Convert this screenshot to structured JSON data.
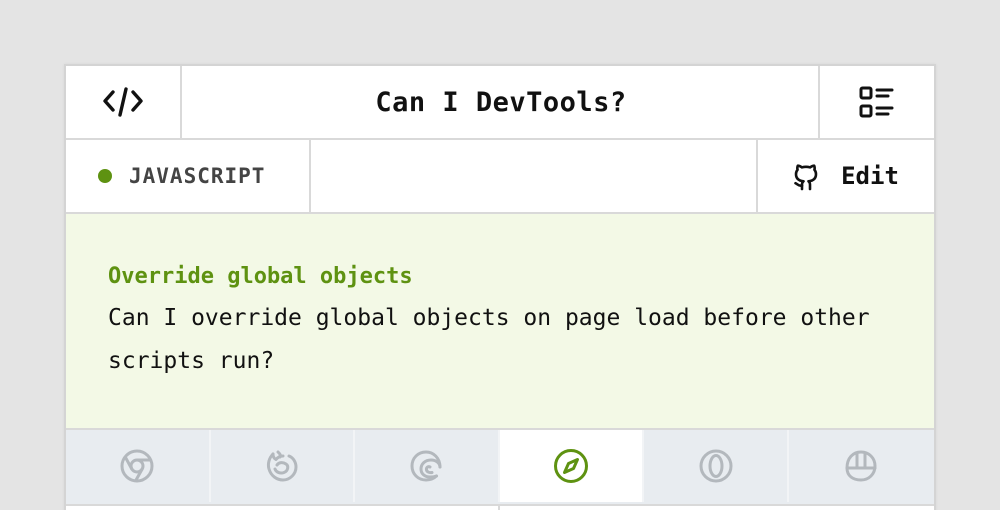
{
  "header": {
    "title": "Can I DevTools?",
    "left_icon": "code-icon",
    "right_icon": "list-view-icon"
  },
  "subbar": {
    "category_label": "JAVASCRIPT",
    "category_color": "#5e9211",
    "edit_label": "Edit",
    "edit_icon": "github-icon"
  },
  "feature": {
    "title": "Override global objects",
    "title_color": "#5e9211",
    "description": "Can I override global objects on page load before other scripts run?",
    "background": "#f3f9e6"
  },
  "browsers": [
    {
      "icon": "chrome-icon",
      "active": false
    },
    {
      "icon": "firefox-icon",
      "active": false
    },
    {
      "icon": "edge-icon",
      "active": false
    },
    {
      "icon": "safari-icon",
      "active": true
    },
    {
      "icon": "opera-icon",
      "active": false
    },
    {
      "icon": "polypane-icon",
      "active": false
    }
  ],
  "colors": {
    "accent": "#5e9211",
    "inactive_icon": "#b3b8bd"
  }
}
